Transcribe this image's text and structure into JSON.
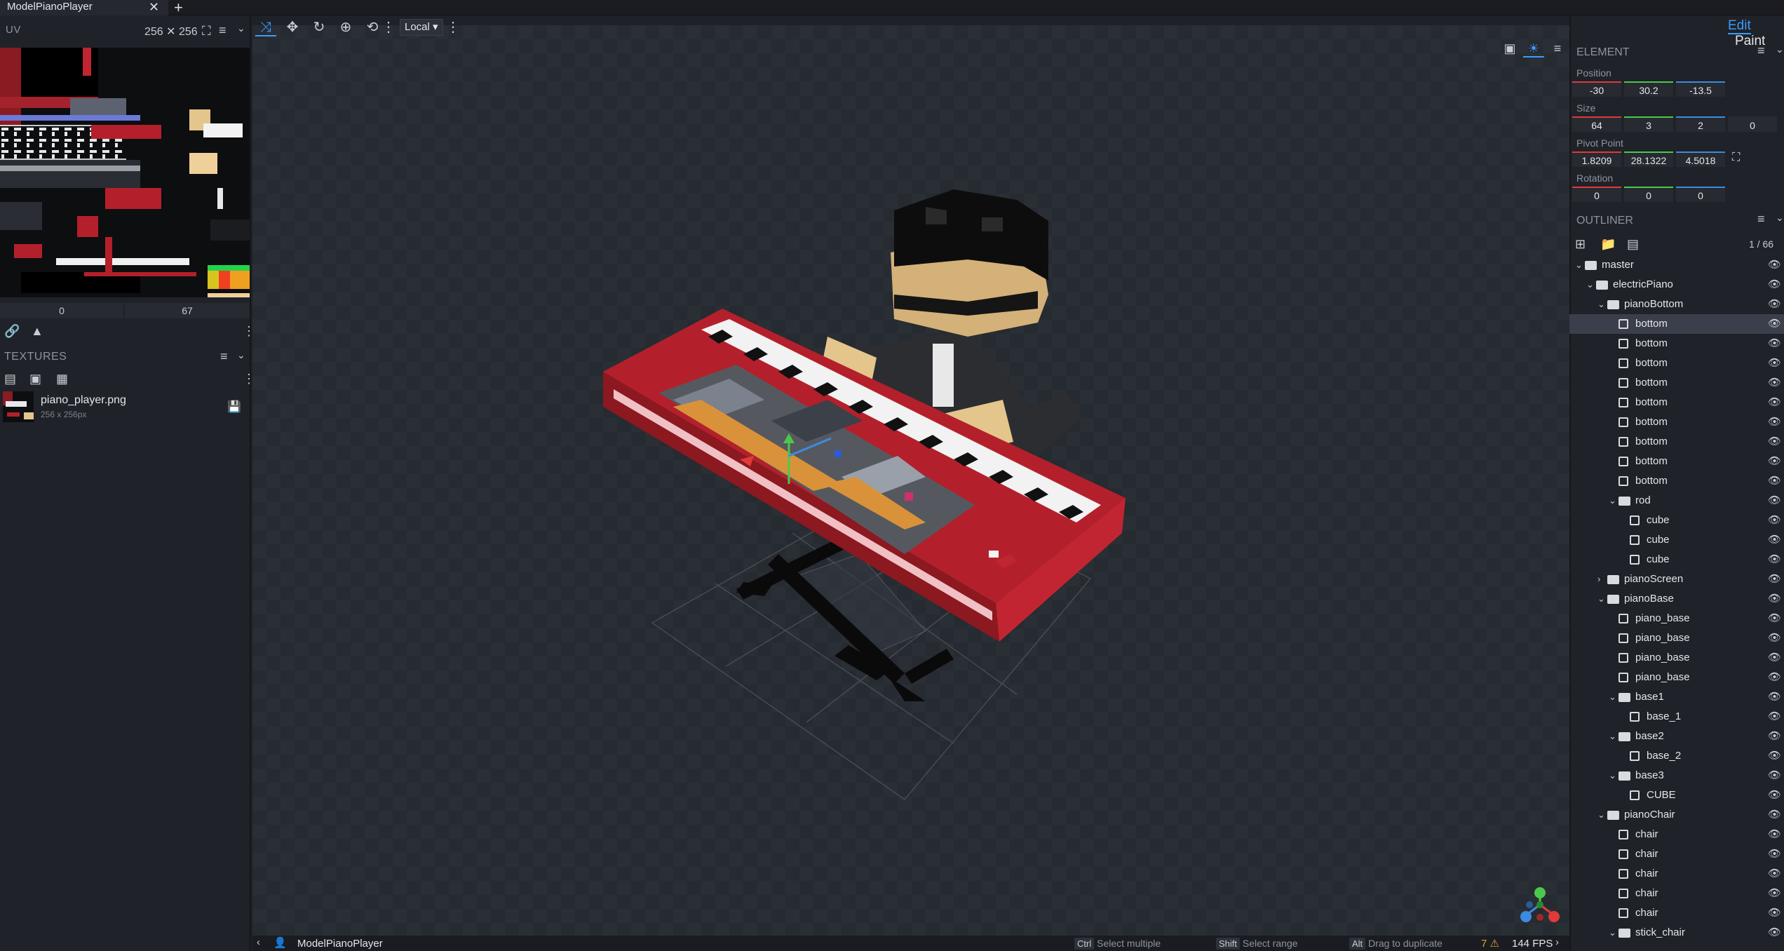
{
  "app": {
    "tab_title": "ModelPianoPlayer",
    "tab_close": "✕",
    "tab_add": "+",
    "modes": [
      "Edit",
      "Paint"
    ]
  },
  "uv": {
    "title": "UV",
    "size_label": "256 ✕ 256",
    "field_left": "0",
    "field_right": "67"
  },
  "textures": {
    "title": "TEXTURES",
    "items": [
      {
        "name": "piano_player.png",
        "dimensions": "256 x 256px"
      }
    ]
  },
  "toolbar": {
    "space": "Local"
  },
  "status": {
    "model_name": "ModelPianoPlayer",
    "hints": [
      {
        "key": "Ctrl",
        "text": "Select multiple"
      },
      {
        "key": "Shift",
        "text": "Select range"
      },
      {
        "key": "Alt",
        "text": "Drag to duplicate"
      }
    ],
    "warnings": "7",
    "fps": "144 FPS"
  },
  "element": {
    "title": "ELEMENT",
    "position_label": "Position",
    "position": [
      "-30",
      "30.2",
      "-13.5"
    ],
    "size_label": "Size",
    "size": [
      "64",
      "3",
      "2",
      "0"
    ],
    "pivot_label": "Pivot Point",
    "pivot": [
      "1.8209",
      "28.1322",
      "4.5018"
    ],
    "rotation_label": "Rotation",
    "rotation": [
      "0",
      "0",
      "0"
    ]
  },
  "outliner": {
    "title": "OUTLINER",
    "count": "1 / 66",
    "rows": [
      {
        "label": "master",
        "type": "group",
        "depth": 0,
        "open": true
      },
      {
        "label": "electricPiano",
        "type": "group",
        "depth": 1,
        "open": true
      },
      {
        "label": "pianoBottom",
        "type": "group",
        "depth": 2,
        "open": true
      },
      {
        "label": "bottom",
        "type": "cube",
        "depth": 3,
        "selected": true
      },
      {
        "label": "bottom",
        "type": "cube",
        "depth": 3
      },
      {
        "label": "bottom",
        "type": "cube",
        "depth": 3
      },
      {
        "label": "bottom",
        "type": "cube",
        "depth": 3
      },
      {
        "label": "bottom",
        "type": "cube",
        "depth": 3
      },
      {
        "label": "bottom",
        "type": "cube",
        "depth": 3
      },
      {
        "label": "bottom",
        "type": "cube",
        "depth": 3
      },
      {
        "label": "bottom",
        "type": "cube",
        "depth": 3
      },
      {
        "label": "bottom",
        "type": "cube",
        "depth": 3
      },
      {
        "label": "rod",
        "type": "group",
        "depth": 3,
        "open": true
      },
      {
        "label": "cube",
        "type": "cube",
        "depth": 4
      },
      {
        "label": "cube",
        "type": "cube",
        "depth": 4
      },
      {
        "label": "cube",
        "type": "cube",
        "depth": 4
      },
      {
        "label": "pianoScreen",
        "type": "group",
        "depth": 2,
        "open": false
      },
      {
        "label": "pianoBase",
        "type": "group",
        "depth": 2,
        "open": true
      },
      {
        "label": "piano_base",
        "type": "cube",
        "depth": 3
      },
      {
        "label": "piano_base",
        "type": "cube",
        "depth": 3
      },
      {
        "label": "piano_base",
        "type": "cube",
        "depth": 3
      },
      {
        "label": "piano_base",
        "type": "cube",
        "depth": 3
      },
      {
        "label": "base1",
        "type": "group",
        "depth": 3,
        "open": true
      },
      {
        "label": "base_1",
        "type": "cube",
        "depth": 4
      },
      {
        "label": "base2",
        "type": "group",
        "depth": 3,
        "open": true
      },
      {
        "label": "base_2",
        "type": "cube",
        "depth": 4
      },
      {
        "label": "base3",
        "type": "group",
        "depth": 3,
        "open": true
      },
      {
        "label": "CUBE",
        "type": "cube",
        "depth": 4
      },
      {
        "label": "pianoChair",
        "type": "group",
        "depth": 2,
        "open": true
      },
      {
        "label": "chair",
        "type": "cube",
        "depth": 3
      },
      {
        "label": "chair",
        "type": "cube",
        "depth": 3
      },
      {
        "label": "chair",
        "type": "cube",
        "depth": 3
      },
      {
        "label": "chair",
        "type": "cube",
        "depth": 3
      },
      {
        "label": "chair",
        "type": "cube",
        "depth": 3
      },
      {
        "label": "stick_chair",
        "type": "group",
        "depth": 3,
        "open": true
      }
    ]
  },
  "colors": {
    "accent": "#3b9cff",
    "piano_red": "#b3202b",
    "axis_x": "#e03a3a",
    "axis_y": "#4bc84b",
    "axis_z": "#3b8ce0"
  }
}
